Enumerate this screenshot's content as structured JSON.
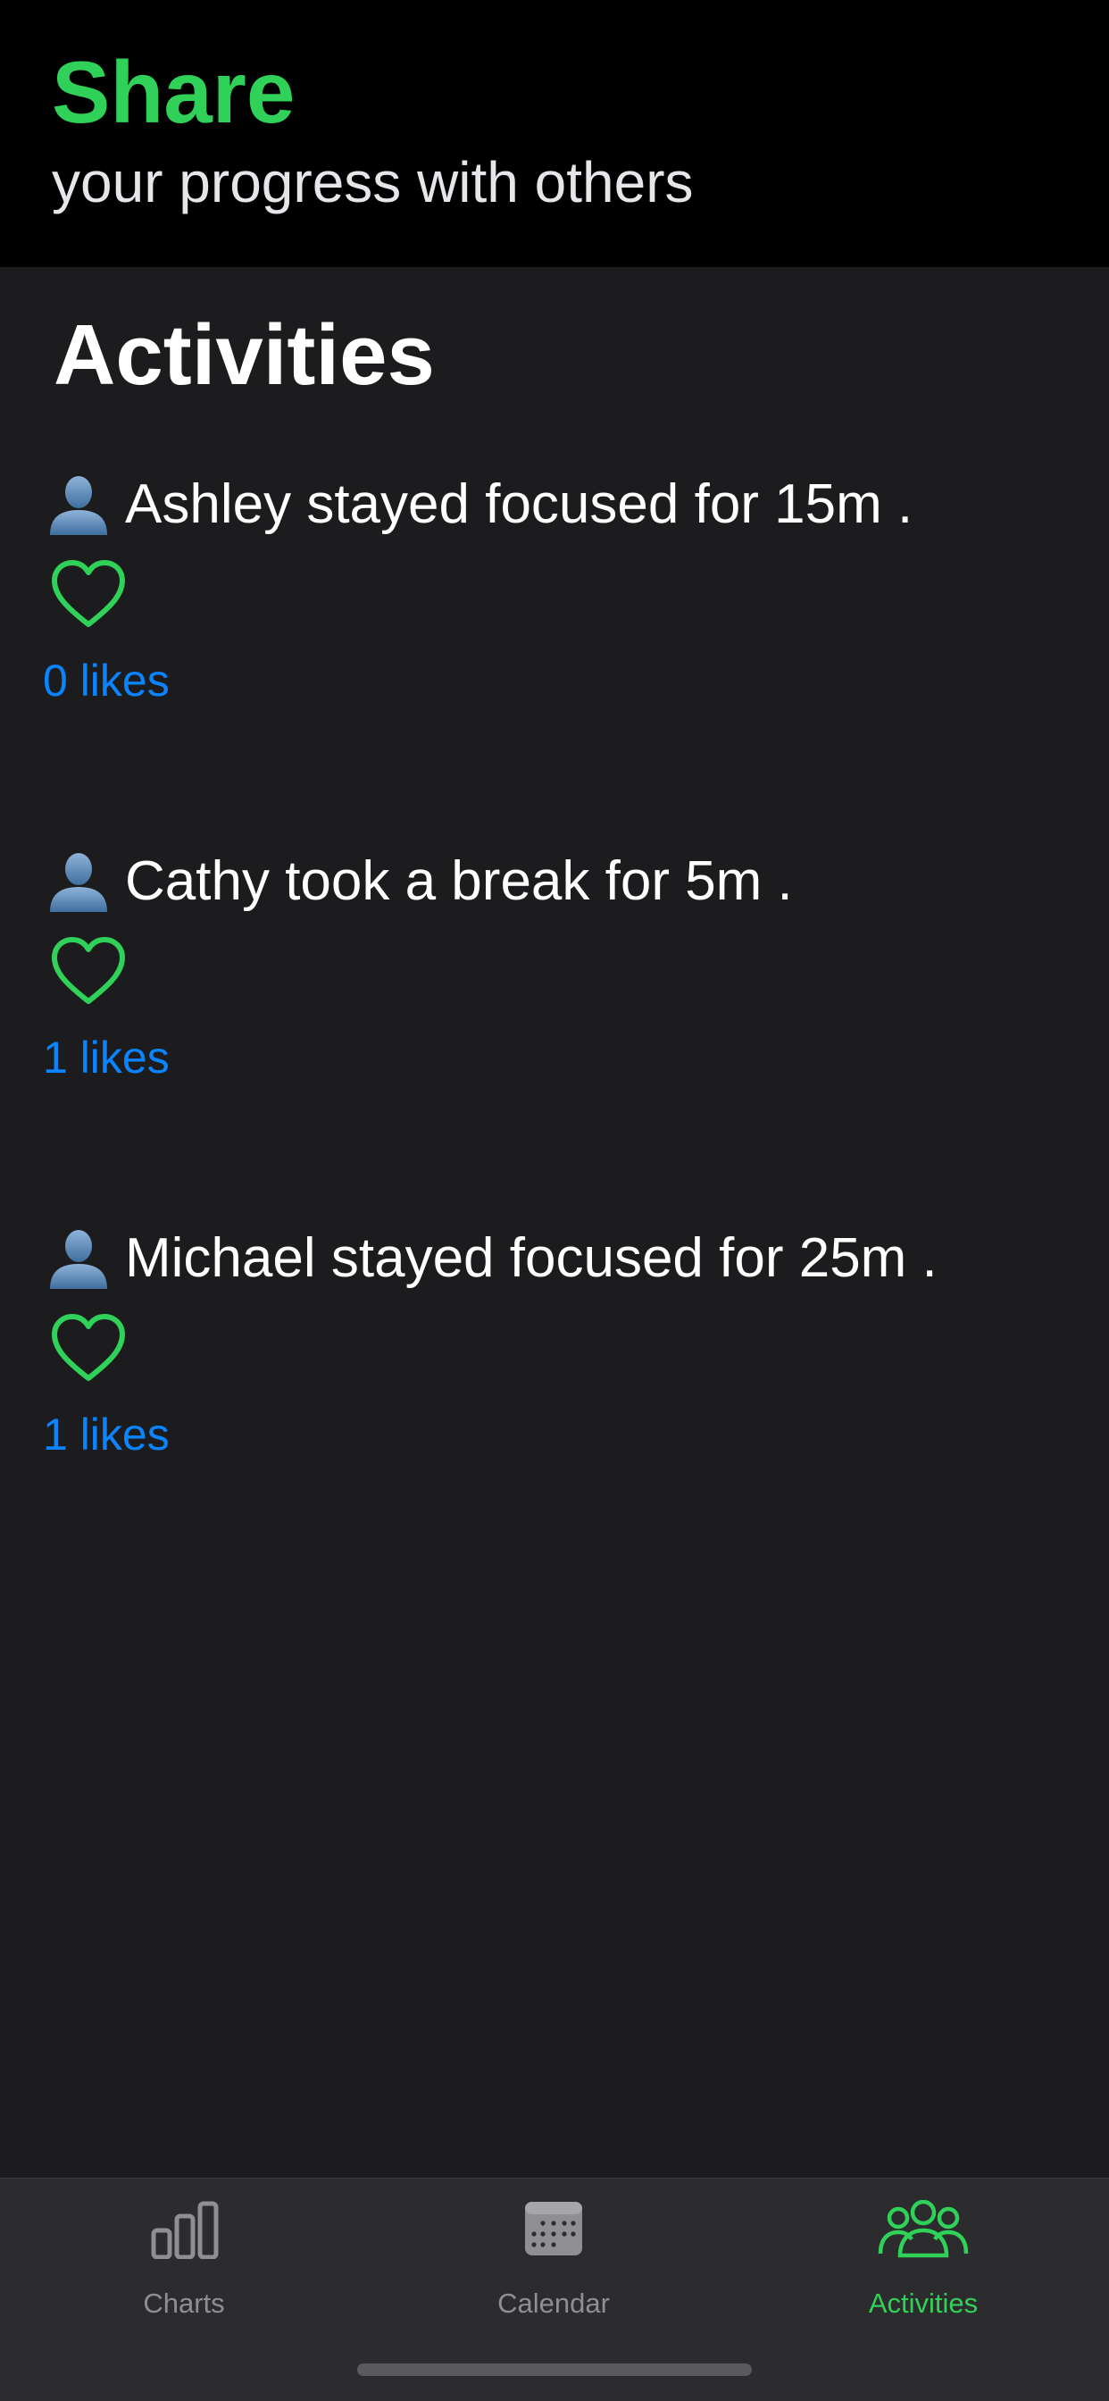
{
  "header": {
    "title": "Share",
    "subtitle": "your progress with others"
  },
  "section": {
    "title": "Activities"
  },
  "activities": [
    {
      "text": "Ashley stayed focused for 15m .",
      "likes_label": "0 likes",
      "likes": 0,
      "liked": false,
      "avatar_icon": "person-silhouette-icon"
    },
    {
      "text": "Cathy took a break for 5m .",
      "likes_label": "1 likes",
      "likes": 1,
      "liked": false,
      "avatar_icon": "person-silhouette-icon"
    },
    {
      "text": "Michael stayed focused for 25m .",
      "likes_label": "1 likes",
      "likes": 1,
      "liked": false,
      "avatar_icon": "person-silhouette-icon"
    }
  ],
  "tabbar": {
    "tabs": [
      {
        "label": "Charts",
        "icon": "bar-chart-icon",
        "active": false
      },
      {
        "label": "Calendar",
        "icon": "calendar-icon",
        "active": false
      },
      {
        "label": "Activities",
        "icon": "people-group-icon",
        "active": true
      }
    ]
  },
  "colors": {
    "accent": "#30d158",
    "link": "#0a84ff",
    "background": "#1c1c1e",
    "header_background": "#000000",
    "tabbar_background": "#2c2c2e",
    "inactive": "#8e8e93"
  }
}
